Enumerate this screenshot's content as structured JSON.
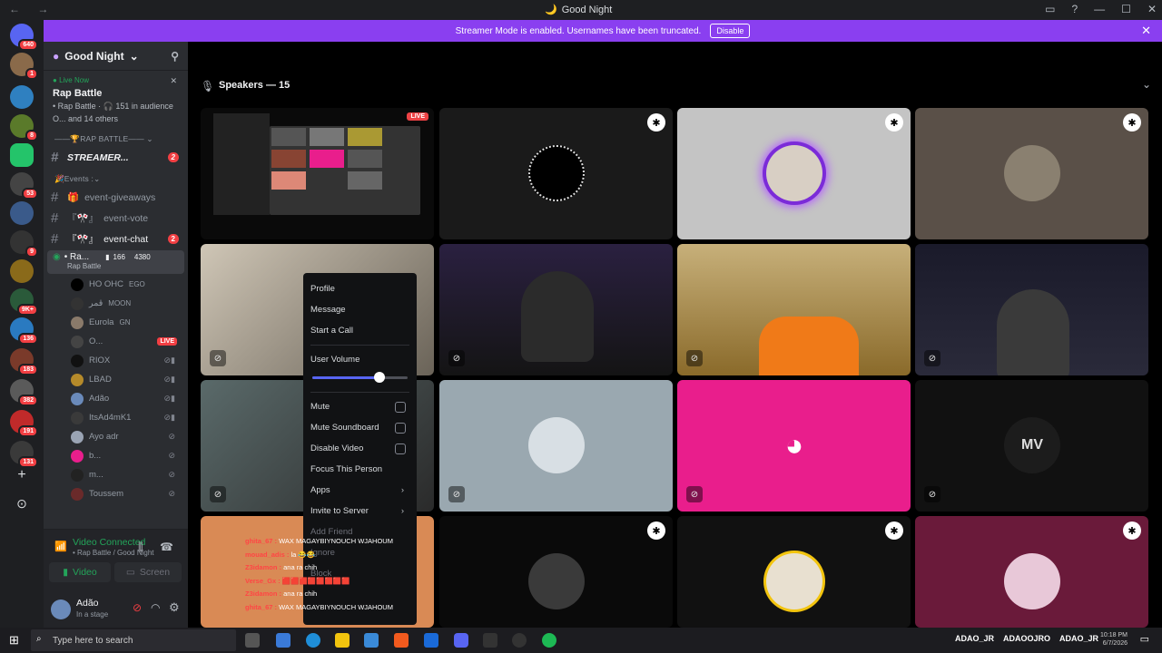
{
  "window": {
    "title": "Good Night",
    "nav": "← →"
  },
  "banner": {
    "text": "Streamer Mode is enabled. Usernames have been truncated.",
    "button": "Disable"
  },
  "rail": {
    "badges": [
      "640",
      "1",
      "8",
      "53",
      "9",
      "136",
      "183",
      "382",
      "191",
      "131"
    ],
    "unread": "9K+"
  },
  "sidebar": {
    "guild_name": "Good Night",
    "live": {
      "status": "Live Now",
      "title": "Rap Battle",
      "meta": "• Rap Battle · 🎧 151 in audience",
      "others": "O... and 14 others"
    },
    "category_rap": "RAP BATTLE",
    "streamer_channel": "STREAMER...",
    "streamer_badge": "2",
    "events_category": "Events :",
    "channels": [
      {
        "name": "event-giveaways",
        "badge": ""
      },
      {
        "name": "event-vote",
        "badge": ""
      },
      {
        "name": "event-chat",
        "badge": "2"
      }
    ],
    "stage": {
      "name": "• Ra...",
      "count": "166",
      "count2": "4380",
      "sub": "Rap Battle"
    },
    "members": [
      {
        "name": "HO OHC",
        "tag": "EGO"
      },
      {
        "name": "قمر",
        "tag": "MOON"
      },
      {
        "name": "Eurola",
        "tag": "GN"
      },
      {
        "name": "O...",
        "tag": "LIVE"
      },
      {
        "name": "RIOX",
        "tag": ""
      },
      {
        "name": "LBAD",
        "tag": ""
      },
      {
        "name": "Adão",
        "tag": ""
      },
      {
        "name": "ItsAd4mK1",
        "tag": ""
      },
      {
        "name": "Ayo adr",
        "tag": ""
      },
      {
        "name": "b...",
        "tag": ""
      },
      {
        "name": "m...",
        "tag": ""
      },
      {
        "name": "Toussem",
        "tag": ""
      }
    ]
  },
  "voice_panel": {
    "status": "Video Connected",
    "sub": "• Rap Battle / Good Night",
    "video_label": "Video",
    "screen_label": "Screen"
  },
  "user_panel": {
    "name": "Adão",
    "status": "In a stage"
  },
  "stage": {
    "speakers_label": "Speakers — 15",
    "live_badge": "LIVE"
  },
  "context_menu": {
    "items": [
      "Profile",
      "Message",
      "Start a Call"
    ],
    "volume_label": "User Volume",
    "volume_level": 0.7,
    "toggles": [
      "Mute",
      "Mute Soundboard",
      "Disable Video"
    ],
    "focus": "Focus This Person",
    "apps": "Apps",
    "invite": "Invite to Server",
    "add_friend": "Add Friend",
    "ignore": "Ignore",
    "block": "Block"
  },
  "chat_overlay": [
    {
      "user": "ghita_67 :",
      "msg": "WAX MAGAYBIYNOUCH WJAHOUM"
    },
    {
      "user": "mouad_adis :",
      "msg": "la 😂😂"
    },
    {
      "user": "Z3idamon :",
      "msg": "ana ra chih"
    },
    {
      "user": "Verse_Gx :",
      "msg": "🟥🟥🟥🟥🟥🟥🟥🟥"
    },
    {
      "user": "Z3idamon :",
      "msg": "ana ra chih"
    },
    {
      "user": "ghita_67 :",
      "msg": "WAX MAGAYBIYNOUCH WJAHOUM"
    }
  ],
  "taskbar": {
    "search_placeholder": "Type here to search",
    "tray": [
      "ADAO_JR",
      "ADAOOJRO",
      "ADAO_JR"
    ],
    "time": "10:18 PM",
    "date": "6/7/2026"
  },
  "colors": {
    "accent": "#5865f2",
    "banner": "#8a3ff0",
    "live": "#ed4245",
    "green": "#23a55a"
  }
}
